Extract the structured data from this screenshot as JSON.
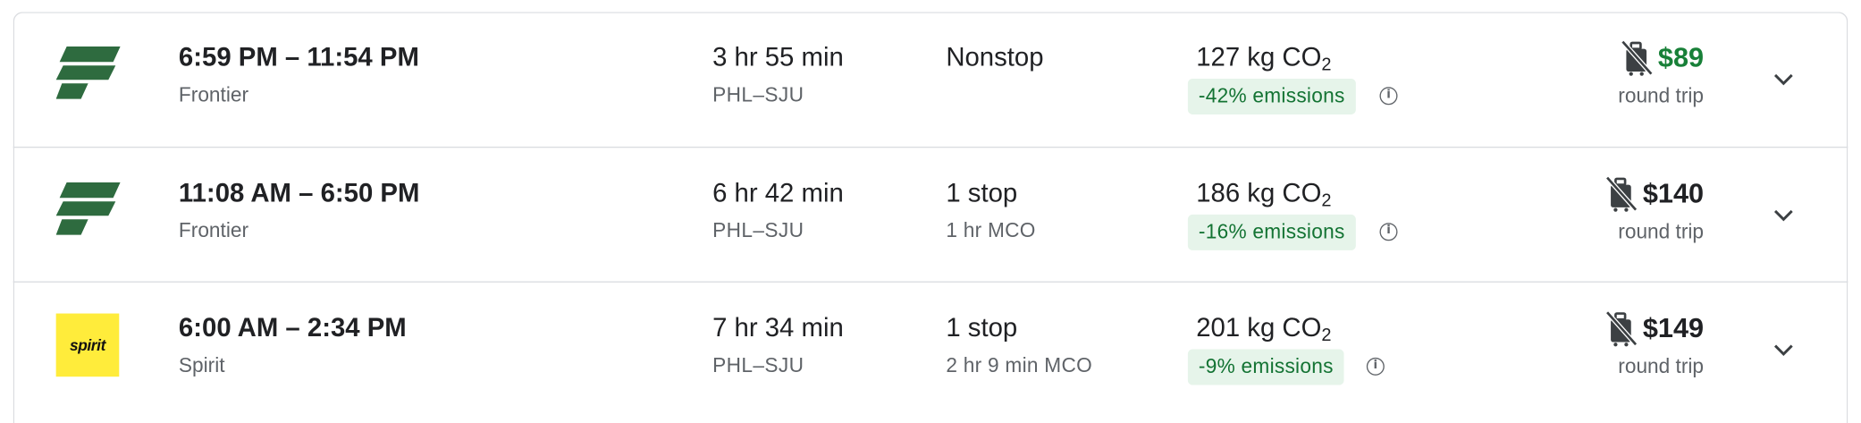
{
  "results": [
    {
      "airline_logo": "frontier-logo",
      "times": "6:59 PM – 11:54 PM",
      "airline": "Frontier",
      "duration": "3 hr 55 min",
      "route": "PHL–SJU",
      "stops": "Nonstop",
      "layover": "",
      "co2_amount": "127 kg CO",
      "co2_sub": "2",
      "emissions": "-42% emissions",
      "price": "$89",
      "price_green": true,
      "price_note": "round trip"
    },
    {
      "airline_logo": "frontier-logo",
      "times": "11:08 AM – 6:50 PM",
      "airline": "Frontier",
      "duration": "6 hr 42 min",
      "route": "PHL–SJU",
      "stops": "1 stop",
      "layover": "1 hr MCO",
      "co2_amount": "186 kg CO",
      "co2_sub": "2",
      "emissions": "-16% emissions",
      "price": "$140",
      "price_green": false,
      "price_note": "round trip"
    },
    {
      "airline_logo": "spirit-logo",
      "logo_text": "spirit",
      "times": "6:00 AM – 2:34 PM",
      "airline": "Spirit",
      "duration": "7 hr 34 min",
      "route": "PHL–SJU",
      "stops": "1 stop",
      "layover": "2 hr 9 min MCO",
      "co2_amount": "201 kg CO",
      "co2_sub": "2",
      "emissions": "-9% emissions",
      "price": "$149",
      "price_green": false,
      "price_note": "round trip"
    }
  ],
  "colors": {
    "frontier_green": "#2e6b3f",
    "spirit_yellow": "#ffec3b",
    "emissions_bg": "#e6f4ea",
    "emissions_text": "#137333",
    "price_green": "#188038"
  },
  "icons": {
    "info": "info-icon",
    "bag": "no-carry-on-bag-icon",
    "expand": "chevron-down-icon"
  }
}
